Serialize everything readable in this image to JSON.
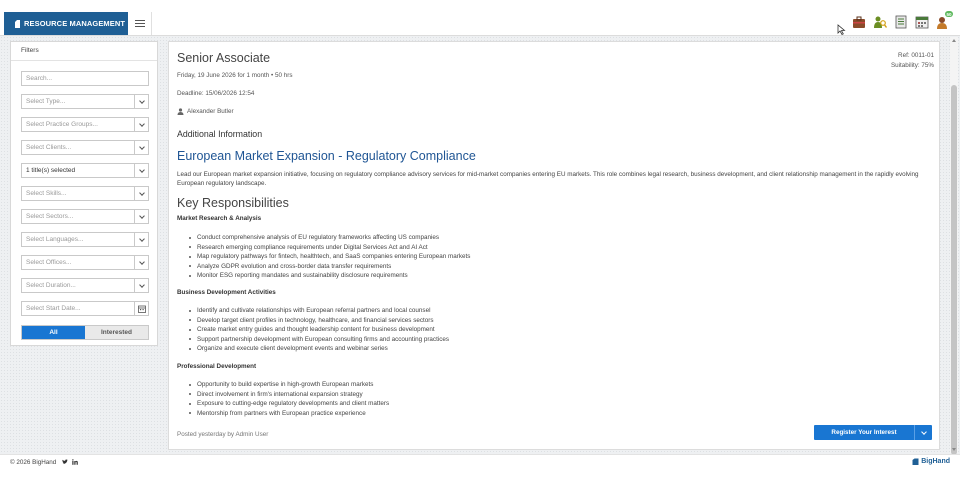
{
  "brand": {
    "label": "RESOURCE MANAGEMENT"
  },
  "topbar": {
    "icons": [
      "briefcase-icon",
      "user-search-icon",
      "building-list-icon",
      "calendar-grid-icon",
      "user-notification-icon"
    ],
    "notification_badge": "50"
  },
  "filters": {
    "title": "Filters",
    "search_placeholder": "Search...",
    "type": "Select Type...",
    "practice_groups": "Select Practice Groups...",
    "clients": "Select Clients...",
    "titles": "1 title(s) selected",
    "skills": "Select Skills...",
    "sectors": "Select Sectors...",
    "languages": "Select Languages...",
    "offices": "Select Offices...",
    "duration": "Select Duration...",
    "start_date_placeholder": "Select Start Date...",
    "toggle_all": "All",
    "toggle_interested": "Interested"
  },
  "job": {
    "title": "Senior Associate",
    "ref": "Ref: 0011-01",
    "suitability": "Suitability: 75%",
    "schedule": "Friday, 19 June 2026 for 1 month • 50 hrs",
    "deadline": "Deadline: 15/06/2026 12:54",
    "contact": "Alexander Butler",
    "additional_info_heading": "Additional Information",
    "project_title": "European Market Expansion - Regulatory Compliance",
    "description": "Lead our European market expansion initiative, focusing on regulatory compliance advisory services for mid-market companies entering EU markets. This role combines legal research, business development, and client relationship management in the rapidly evolving European regulatory landscape.",
    "responsibilities_heading": "Key Responsibilities",
    "sections": [
      {
        "heading": "Market Research & Analysis",
        "items": [
          "Conduct comprehensive analysis of EU regulatory frameworks affecting US companies",
          "Research emerging compliance requirements under Digital Services Act and AI Act",
          "Map regulatory pathways for fintech, healthtech, and SaaS companies entering European markets",
          "Analyze GDPR evolution and cross-border data transfer requirements",
          "Monitor ESG reporting mandates and sustainability disclosure requirements"
        ]
      },
      {
        "heading": "Business Development Activities",
        "items": [
          "Identify and cultivate relationships with European referral partners and local counsel",
          "Develop target client profiles in technology, healthcare, and financial services sectors",
          "Create market entry guides and thought leadership content for business development",
          "Support partnership development with European consulting firms and accounting practices",
          "Organize and execute client development events and webinar series"
        ]
      },
      {
        "heading": "Professional Development",
        "items": [
          "Opportunity to build expertise in high-growth European markets",
          "Direct involvement in firm's international expansion strategy",
          "Exposure to cutting-edge regulatory developments and client matters",
          "Mentorship from partners with European practice experience"
        ]
      }
    ],
    "posted": "Posted yesterday by Admin User",
    "register_button": "Register Your Interest"
  },
  "footer": {
    "copyright": "© 2026 BigHand",
    "brand": "BigHand"
  },
  "colors": {
    "brand": "#1f5f95",
    "accent": "#1976d2",
    "link_heading": "#1f5594"
  }
}
